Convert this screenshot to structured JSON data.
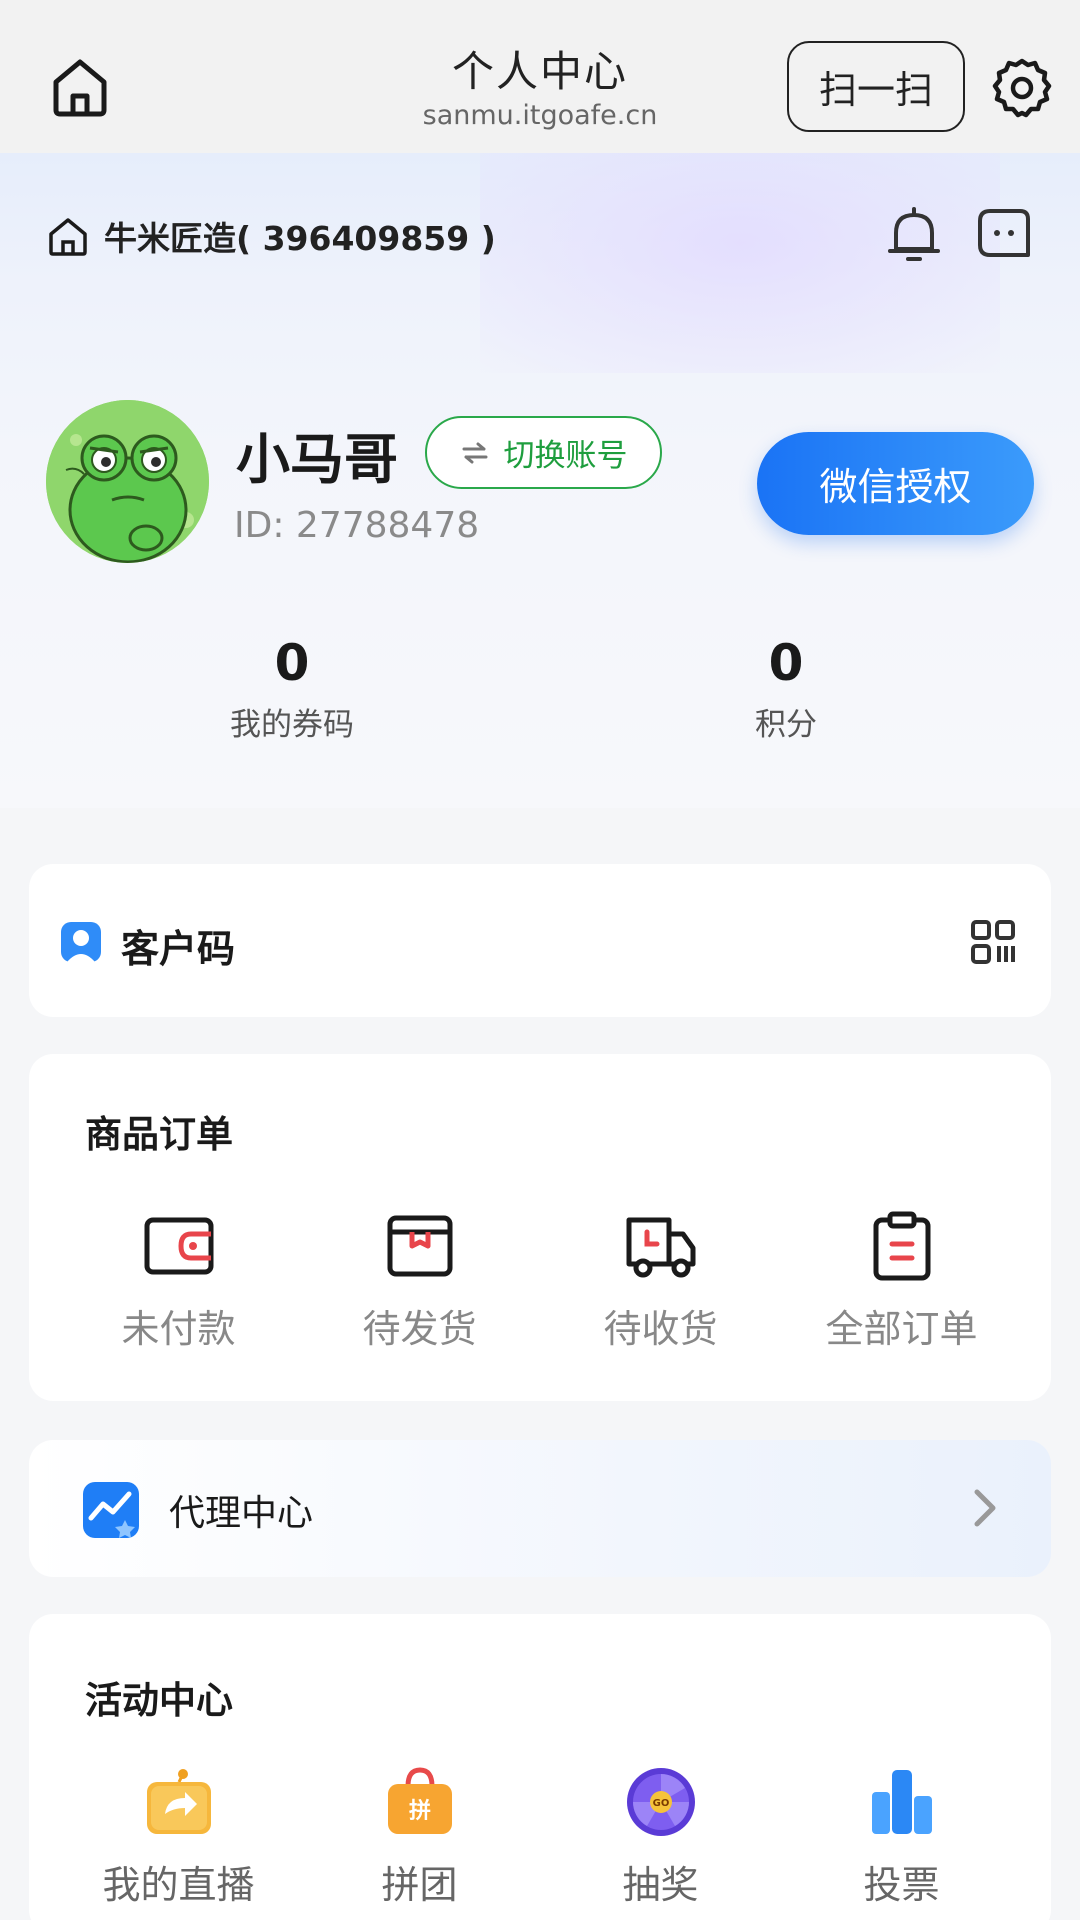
{
  "navbar": {
    "title": "个人中心",
    "subtitle": "sanmu.itgoafe.cn",
    "scan_label": "扫一扫"
  },
  "shop": {
    "name": "牛米匠造( 396409859 )"
  },
  "user": {
    "name": "小马哥",
    "switch_label": "切换账号",
    "id_text": "ID: 27788478",
    "wechat_auth_label": "微信授权"
  },
  "stats": [
    {
      "value": "0",
      "label": "我的券码"
    },
    {
      "value": "0",
      "label": "积分"
    }
  ],
  "customer_code": {
    "label": "客户码"
  },
  "orders": {
    "title": "商品订单",
    "items": [
      {
        "label": "未付款",
        "icon": "wallet-icon"
      },
      {
        "label": "待发货",
        "icon": "package-icon"
      },
      {
        "label": "待收货",
        "icon": "truck-icon"
      },
      {
        "label": "全部订单",
        "icon": "clipboard-icon"
      }
    ]
  },
  "agent": {
    "label": "代理中心"
  },
  "activities": {
    "title": "活动中心",
    "items": [
      {
        "label": "我的直播",
        "icon": "live-share-icon"
      },
      {
        "label": "拼团",
        "icon": "group-buy-bag-icon"
      },
      {
        "label": "抽奖",
        "icon": "lottery-wheel-icon"
      },
      {
        "label": "投票",
        "icon": "vote-bars-icon"
      }
    ]
  },
  "colors": {
    "accent": "#1a73f5",
    "switch_green": "#1e9e3e",
    "order_icon_red": "#e8454b"
  }
}
